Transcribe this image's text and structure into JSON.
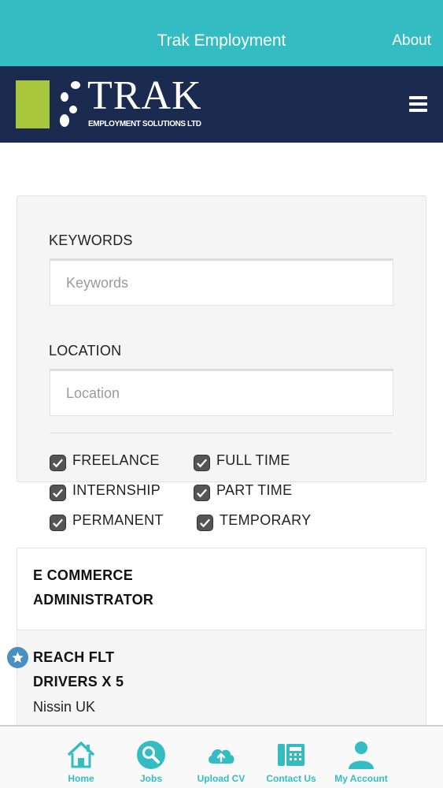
{
  "header": {
    "title": "Trak Employment",
    "about_label": "About"
  },
  "brand": {
    "logo_text": "TRAK",
    "logo_subtitle": "EMPLOYMENT SOLUTIONS LTD",
    "menu_icon": "hamburger-icon"
  },
  "search": {
    "keywords_label": "KEYWORDS",
    "keywords_placeholder": "Keywords",
    "keywords_value": "",
    "location_label": "LOCATION",
    "location_placeholder": "Location",
    "location_value": ""
  },
  "job_types": [
    {
      "label": "FREELANCE",
      "checked": true
    },
    {
      "label": "FULL TIME",
      "checked": true
    },
    {
      "label": "INTERNSHIP",
      "checked": true
    },
    {
      "label": "PART TIME",
      "checked": true
    },
    {
      "label": "PERMANENT",
      "checked": true
    },
    {
      "label": "TEMPORARY",
      "checked": true
    }
  ],
  "jobs": [
    {
      "title_line1": "E COMMERCE",
      "title_line2": "ADMINISTRATOR",
      "company": "",
      "featured": false
    },
    {
      "title_line1": "REACH FLT",
      "title_line2": "DRIVERS X 5",
      "company": "Nissin UK",
      "featured": true
    }
  ],
  "nav": [
    {
      "label": "Home",
      "icon": "home-icon"
    },
    {
      "label": "Jobs",
      "icon": "search-icon"
    },
    {
      "label": "Upload CV",
      "icon": "cloud-upload-icon"
    },
    {
      "label": "Contact Us",
      "icon": "phone-icon"
    },
    {
      "label": "My Account",
      "icon": "user-icon"
    }
  ],
  "colors": {
    "accent": "#33bdc2",
    "brand_navy": "#1b2b4f",
    "logo_green": "#a8c73c",
    "star_blue": "#4a8fc0"
  }
}
